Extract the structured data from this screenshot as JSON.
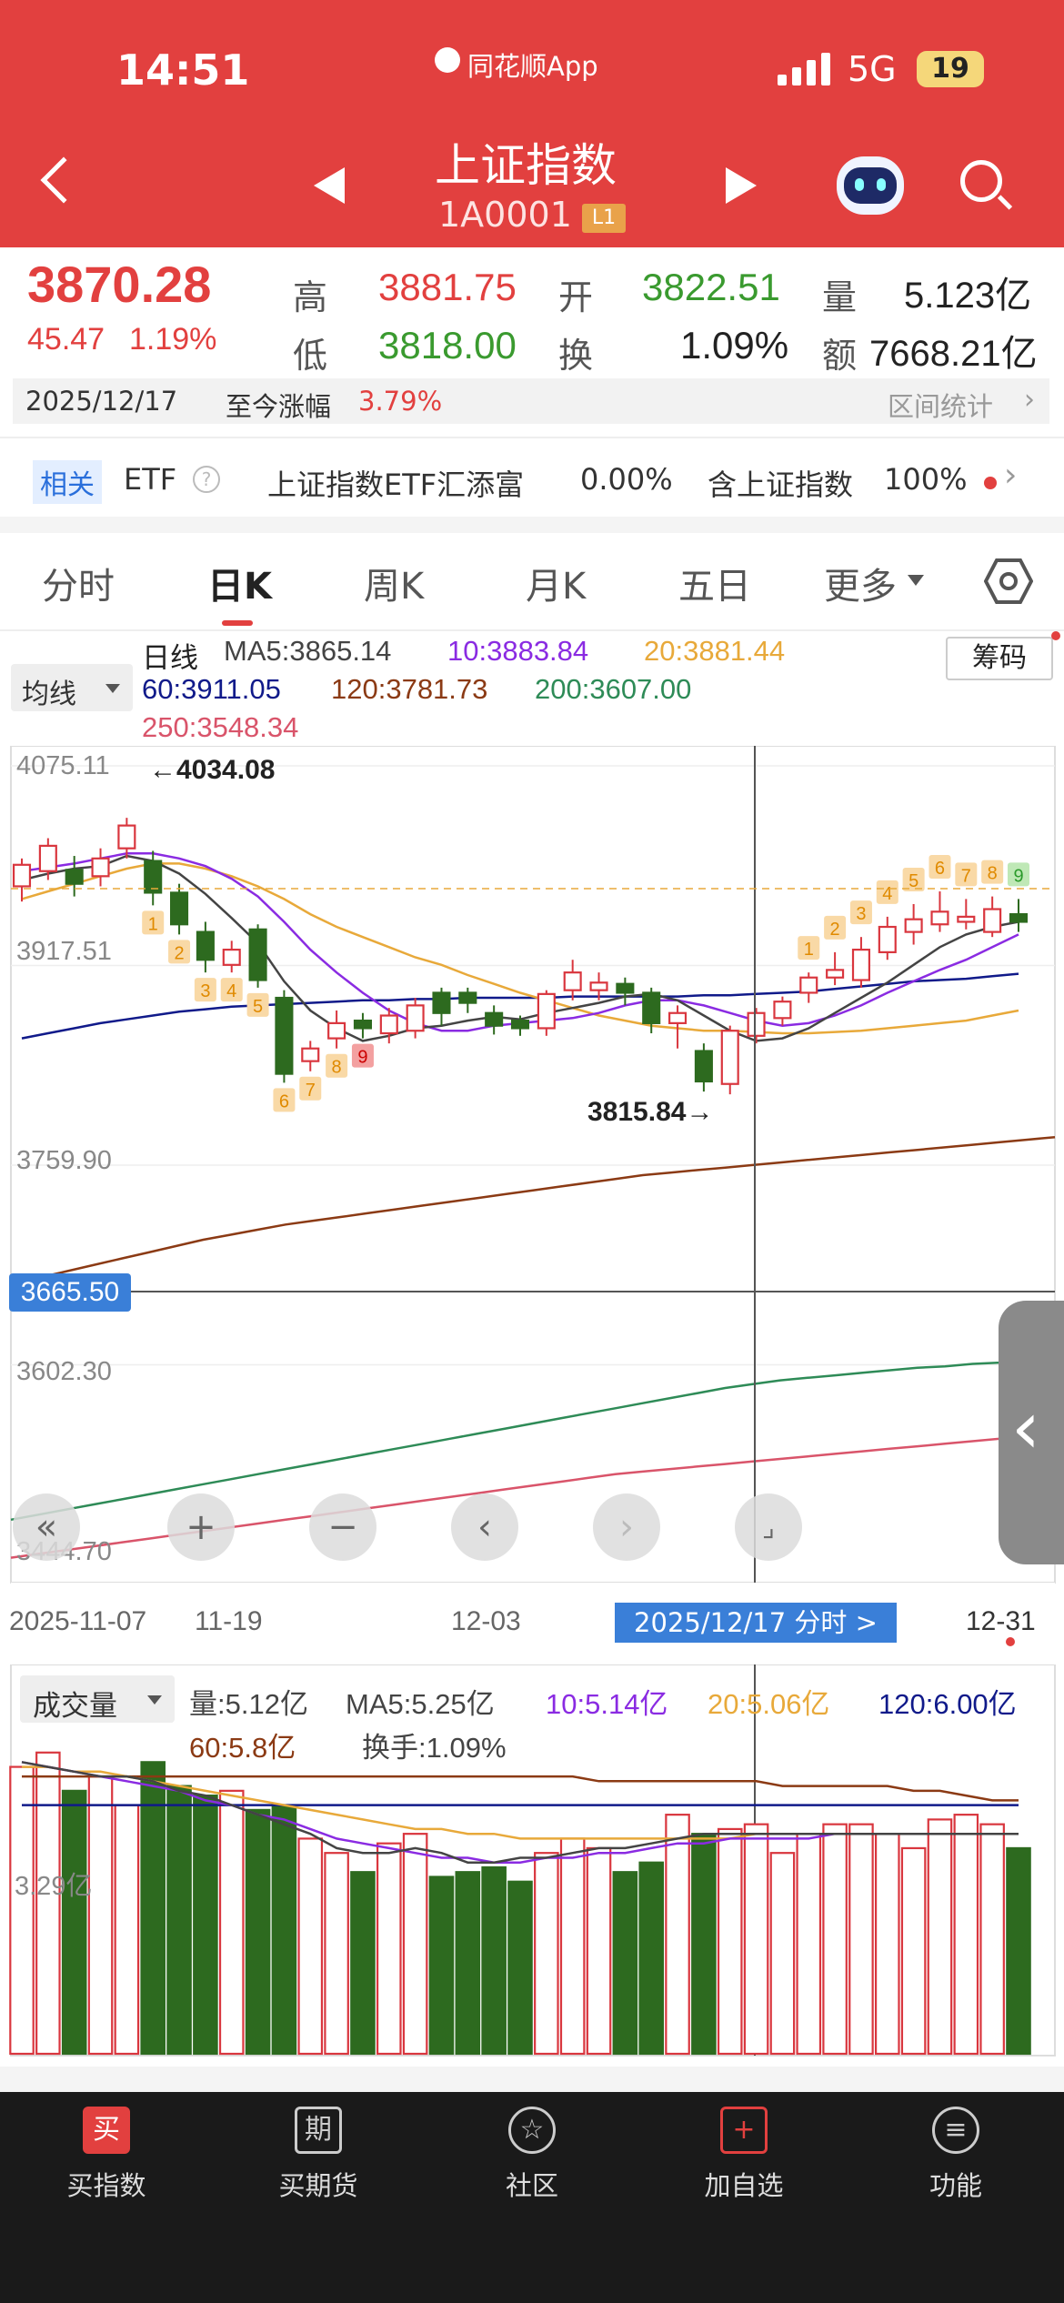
{
  "status_bar": {
    "time": "14:51",
    "app_name": "同花顺App",
    "network": "5G",
    "battery": "19"
  },
  "title_bar": {
    "title": "上证指数",
    "code": "1A0001",
    "level_badge": "L1"
  },
  "quote": {
    "price": "3870.28",
    "change": "45.47",
    "change_pct": "1.19%",
    "high_label": "高",
    "high": "3881.75",
    "open_label": "开",
    "open": "3822.51",
    "volume_label": "量",
    "volume": "5.123亿",
    "low_label": "低",
    "low": "3818.00",
    "turnover_label": "换",
    "turnover": "1.09%",
    "amount_label": "额",
    "amount": "7668.21亿"
  },
  "range_bar": {
    "date": "2025/12/17",
    "label": "至今涨幅",
    "value": "3.79%",
    "stats_label": "区间统计"
  },
  "etf_bar": {
    "tag": "相关",
    "etf": "ETF",
    "fund_name": "上证指数ETF汇添富",
    "fund_change": "0.00%",
    "holding_label": "含上证指数",
    "holding_pct": "100%"
  },
  "tabs": [
    "分时",
    "日K",
    "周K",
    "月K",
    "五日",
    "更多"
  ],
  "active_tab": "日K",
  "ma_legend": {
    "mode": "均线",
    "period": "日线",
    "ma5": "MA5:3865.14",
    "ma10": "10:3883.84",
    "ma20": "20:3881.44",
    "ma60": "60:3911.05",
    "ma120": "120:3781.73",
    "ma200": "200:3607.00",
    "ma250": "250:3548.34",
    "chips_button": "筹码"
  },
  "price_axis": [
    "4075.11",
    "3917.51",
    "3759.90",
    "3602.30",
    "3444.70"
  ],
  "crosshair_price": "3665.50",
  "annotations": {
    "high": "←4034.08",
    "low": "3815.84→"
  },
  "date_axis": {
    "start": "2025-11-07",
    "tick2": "11-19",
    "tick3": "12-03",
    "selected": "2025/12/17 分时 >",
    "end": "12-31"
  },
  "volume_legend": {
    "mode": "成交量",
    "vol": "量:5.12亿",
    "ma5": "MA5:5.25亿",
    "ma10": "10:5.14亿",
    "ma20": "20:5.06亿",
    "ma120": "120:6.00亿",
    "ma60": "60:5.8亿",
    "turnover": "换手:1.09%",
    "axis_label": "3.29亿"
  },
  "bottom_nav": [
    {
      "icon": "买",
      "label": "买指数"
    },
    {
      "icon": "期",
      "label": "买期货"
    },
    {
      "icon": "☆",
      "label": "社区"
    },
    {
      "icon": "+",
      "label": "加自选"
    },
    {
      "icon": "≡",
      "label": "功能"
    }
  ],
  "colors": {
    "brand_red": "#e2403f",
    "down_green": "#2d6a1f",
    "ma5": "#444444",
    "ma10": "#8a2be2",
    "ma20": "#e8a93a",
    "ma60": "#101a8a",
    "ma120": "#8b3a14",
    "ma200": "#2e8b57",
    "ma250": "#d9546a"
  },
  "chart_data": {
    "type": "candlestick",
    "x_start": "2025-11-07",
    "x_end": "2025-12-31",
    "ylim": [
      3444.7,
      4075.11
    ],
    "candles": [
      [
        3980,
        3997,
        3968,
        4002
      ],
      [
        3992,
        4012,
        3985,
        4018
      ],
      [
        3993,
        3982,
        3972,
        4004
      ],
      [
        3988,
        4002,
        3980,
        4010
      ],
      [
        4010,
        4028,
        4002,
        4034.08
      ],
      [
        4000,
        3975,
        3965,
        4008
      ],
      [
        3975,
        3950,
        3942,
        3982
      ],
      [
        3944,
        3922,
        3912,
        3952
      ],
      [
        3918,
        3930,
        3912,
        3937
      ],
      [
        3946,
        3906,
        3900,
        3950
      ],
      [
        3892,
        3832,
        3825,
        3898
      ],
      [
        3842,
        3852,
        3834,
        3858
      ],
      [
        3860,
        3872,
        3852,
        3882
      ],
      [
        3874,
        3868,
        3860,
        3880
      ],
      [
        3864,
        3878,
        3856,
        3884
      ],
      [
        3866,
        3886,
        3860,
        3892
      ],
      [
        3896,
        3880,
        3870,
        3900
      ],
      [
        3896,
        3888,
        3880,
        3900
      ],
      [
        3880,
        3870,
        3863,
        3886
      ],
      [
        3874,
        3868,
        3862,
        3878
      ],
      [
        3868,
        3895,
        3862,
        3898
      ],
      [
        3898,
        3912,
        3890,
        3922
      ],
      [
        3898,
        3904,
        3890,
        3912
      ],
      [
        3903,
        3896,
        3886,
        3908
      ],
      [
        3896,
        3872,
        3864,
        3900
      ],
      [
        3872,
        3880,
        3852,
        3886
      ],
      [
        3850,
        3826,
        3818,
        3856
      ],
      [
        3824,
        3866,
        3815.84,
        3870
      ],
      [
        3862,
        3880,
        3856,
        3884
      ],
      [
        3876,
        3889,
        3870,
        3893
      ],
      [
        3896,
        3908,
        3888,
        3912
      ],
      [
        3908,
        3914,
        3902,
        3928
      ],
      [
        3906,
        3930,
        3900,
        3940
      ],
      [
        3928,
        3948,
        3922,
        3956
      ],
      [
        3944,
        3954,
        3934,
        3966
      ],
      [
        3950,
        3960,
        3944,
        3976
      ],
      [
        3952,
        3956,
        3946,
        3970
      ],
      [
        3944,
        3962,
        3940,
        3972
      ],
      [
        3958,
        3952,
        3944,
        3970
      ]
    ],
    "seq_counts": [
      {
        "i": 5,
        "n": "1",
        "dir": "down"
      },
      {
        "i": 6,
        "n": "2",
        "dir": "down"
      },
      {
        "i": 7,
        "n": "3",
        "dir": "down"
      },
      {
        "i": 8,
        "n": "4",
        "dir": "down"
      },
      {
        "i": 9,
        "n": "5",
        "dir": "down"
      },
      {
        "i": 10,
        "n": "6",
        "dir": "down"
      },
      {
        "i": 11,
        "n": "7",
        "dir": "down"
      },
      {
        "i": 12,
        "n": "8",
        "dir": "down"
      },
      {
        "i": 13,
        "n": "9",
        "dir": "down9"
      },
      {
        "i": 30,
        "n": "1",
        "dir": "up"
      },
      {
        "i": 31,
        "n": "2",
        "dir": "up"
      },
      {
        "i": 32,
        "n": "3",
        "dir": "up"
      },
      {
        "i": 33,
        "n": "4",
        "dir": "up"
      },
      {
        "i": 34,
        "n": "5",
        "dir": "up"
      },
      {
        "i": 35,
        "n": "6",
        "dir": "up"
      },
      {
        "i": 36,
        "n": "7",
        "dir": "up"
      },
      {
        "i": 37,
        "n": "8",
        "dir": "up"
      },
      {
        "i": 38,
        "n": "9",
        "dir": "up9"
      }
    ],
    "ma5": [
      3985,
      3990,
      3994,
      3996,
      4004,
      4000,
      3990,
      3974,
      3955,
      3935,
      3905,
      3882,
      3868,
      3858,
      3862,
      3868,
      3870,
      3874,
      3877,
      3875,
      3880,
      3884,
      3888,
      3893,
      3895,
      3890,
      3878,
      3866,
      3858,
      3860,
      3868,
      3880,
      3892,
      3904,
      3918,
      3932,
      3942,
      3948,
      3952
    ],
    "ma10": [
      3992,
      3995,
      3998,
      4002,
      4006,
      4006,
      4002,
      3996,
      3986,
      3972,
      3952,
      3930,
      3912,
      3896,
      3882,
      3872,
      3866,
      3866,
      3870,
      3872,
      3874,
      3876,
      3880,
      3886,
      3890,
      3890,
      3886,
      3880,
      3874,
      3870,
      3872,
      3878,
      3886,
      3896,
      3905,
      3914,
      3922,
      3932,
      3942
    ],
    "ma20": [
      3970,
      3976,
      3982,
      3988,
      3994,
      3998,
      3998,
      3994,
      3988,
      3980,
      3970,
      3958,
      3948,
      3940,
      3932,
      3924,
      3918,
      3910,
      3903,
      3896,
      3890,
      3884,
      3878,
      3874,
      3870,
      3868,
      3866,
      3866,
      3865,
      3864,
      3864,
      3865,
      3866,
      3868,
      3870,
      3872,
      3874,
      3878,
      3882
    ],
    "ma60": [
      3860,
      3864,
      3868,
      3872,
      3875,
      3878,
      3881,
      3883,
      3885,
      3886,
      3887,
      3888,
      3889,
      3890,
      3890,
      3891,
      3891,
      3892,
      3892,
      3892,
      3892,
      3893,
      3893,
      3893,
      3893,
      3893,
      3894,
      3894,
      3895,
      3896,
      3897,
      3899,
      3901,
      3903,
      3905,
      3906,
      3907,
      3909,
      3911
    ],
    "ma120": [
      3666,
      3671,
      3676,
      3681,
      3686,
      3691,
      3696,
      3701,
      3705,
      3709,
      3713,
      3716,
      3719,
      3722,
      3725,
      3728,
      3731,
      3734,
      3737,
      3740,
      3743,
      3746,
      3749,
      3752,
      3754,
      3756,
      3758,
      3760,
      3762,
      3764,
      3766,
      3768,
      3770,
      3772,
      3774,
      3776,
      3778,
      3780,
      3782
    ],
    "ma200": [
      3480,
      3484,
      3488,
      3492,
      3496,
      3500,
      3504,
      3508,
      3512,
      3516,
      3520,
      3524,
      3528,
      3532,
      3536,
      3540,
      3544,
      3548,
      3552,
      3556,
      3560,
      3564,
      3568,
      3572,
      3576,
      3580,
      3584,
      3587,
      3590,
      3592,
      3594,
      3596,
      3598,
      3600,
      3601,
      3603,
      3604,
      3606,
      3607
    ],
    "ma250": [
      3450,
      3453,
      3456,
      3459,
      3462,
      3465,
      3468,
      3471,
      3474,
      3477,
      3480,
      3483,
      3486,
      3489,
      3492,
      3495,
      3498,
      3501,
      3504,
      3507,
      3510,
      3513,
      3516,
      3518,
      3520,
      3522,
      3524,
      3526,
      3528,
      3530,
      3532,
      3534,
      3536,
      3538,
      3540,
      3542,
      3544,
      3546,
      3548
    ],
    "volume": [
      6.0,
      6.3,
      5.5,
      5.8,
      5.2,
      6.1,
      5.6,
      5.4,
      5.5,
      5.1,
      5.2,
      4.5,
      4.2,
      3.8,
      4.4,
      4.6,
      3.7,
      3.8,
      3.9,
      3.6,
      4.2,
      4.5,
      4.3,
      3.8,
      4.0,
      5.0,
      4.6,
      4.7,
      4.8,
      4.2,
      4.6,
      4.8,
      4.8,
      4.6,
      4.3,
      4.9,
      5.0,
      4.8,
      4.3
    ],
    "vol_ma_blue": [
      5.2,
      5.2,
      5.2,
      5.2,
      5.2,
      5.2,
      5.2,
      5.2,
      5.2,
      5.2,
      5.2,
      5.2,
      5.2,
      5.2,
      5.2,
      5.2,
      5.2,
      5.2,
      5.2,
      5.2,
      5.2,
      5.2,
      5.2,
      5.2,
      5.2,
      5.2,
      5.2,
      5.2,
      5.2,
      5.2,
      5.2,
      5.2,
      5.2,
      5.2,
      5.2,
      5.2,
      5.2,
      5.2,
      5.2
    ],
    "vol_ma5": [
      6.1,
      6.0,
      5.9,
      5.8,
      5.8,
      5.7,
      5.5,
      5.4,
      5.2,
      5.0,
      4.8,
      4.6,
      4.3,
      4.2,
      4.2,
      4.3,
      4.2,
      4.0,
      4.0,
      4.1,
      4.1,
      4.2,
      4.3,
      4.3,
      4.4,
      4.5,
      4.6,
      4.6,
      4.6,
      4.6,
      4.6,
      4.6,
      4.6,
      4.6,
      4.6,
      4.6,
      4.6,
      4.6,
      4.6
    ],
    "vol_ma20": [
      6.0,
      6.0,
      5.9,
      5.9,
      5.8,
      5.7,
      5.6,
      5.5,
      5.4,
      5.3,
      5.2,
      5.1,
      5.0,
      4.9,
      4.8,
      4.7,
      4.7,
      4.6,
      4.6,
      4.5,
      4.5,
      4.5,
      4.5,
      4.5,
      4.5,
      4.5,
      4.5,
      4.5,
      4.6,
      4.6,
      4.6,
      4.6,
      4.6,
      4.6,
      4.6,
      4.6,
      4.6,
      4.6,
      4.6
    ],
    "vol_ma10": [
      6.1,
      6.0,
      5.9,
      5.8,
      5.7,
      5.6,
      5.5,
      5.3,
      5.2,
      5.0,
      4.9,
      4.7,
      4.5,
      4.4,
      4.3,
      4.2,
      4.1,
      4.1,
      4.0,
      4.0,
      4.1,
      4.1,
      4.2,
      4.2,
      4.3,
      4.4,
      4.4,
      4.5,
      4.5,
      4.5,
      4.5,
      4.6,
      4.6,
      4.6,
      4.6,
      4.6,
      4.6,
      4.6,
      4.6
    ],
    "vol_ma60": [
      5.8,
      5.8,
      5.8,
      5.8,
      5.8,
      5.8,
      5.8,
      5.8,
      5.8,
      5.8,
      5.8,
      5.8,
      5.8,
      5.8,
      5.8,
      5.8,
      5.8,
      5.8,
      5.8,
      5.8,
      5.8,
      5.8,
      5.7,
      5.7,
      5.7,
      5.7,
      5.7,
      5.7,
      5.7,
      5.6,
      5.6,
      5.6,
      5.6,
      5.6,
      5.5,
      5.5,
      5.4,
      5.3,
      5.3
    ],
    "vol_ylim": [
      0,
      7.0
    ]
  }
}
